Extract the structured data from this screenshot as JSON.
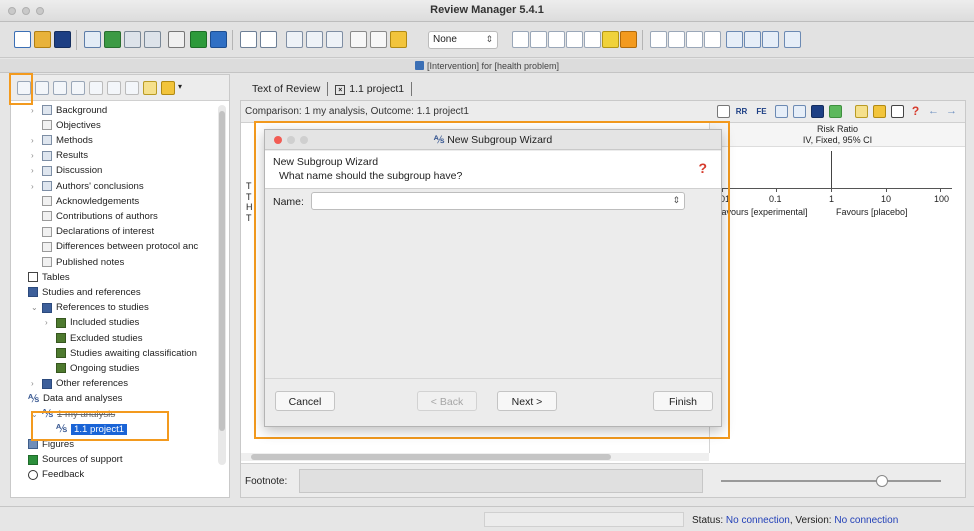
{
  "app": {
    "title": "Review Manager 5.4.1"
  },
  "toolbar": {
    "style_value": "None"
  },
  "document": {
    "window_title": "[Intervention] for [health problem]"
  },
  "sidebar": {
    "items": [
      {
        "label": "Background",
        "indent": 1,
        "icon": "section",
        "twisty": ">"
      },
      {
        "label": "Objectives",
        "indent": 1,
        "icon": "doc",
        "twisty": ""
      },
      {
        "label": "Methods",
        "indent": 1,
        "icon": "section",
        "twisty": ">"
      },
      {
        "label": "Results",
        "indent": 1,
        "icon": "section",
        "twisty": ">"
      },
      {
        "label": "Discussion",
        "indent": 1,
        "icon": "section",
        "twisty": ">"
      },
      {
        "label": "Authors' conclusions",
        "indent": 1,
        "icon": "section",
        "twisty": ">"
      },
      {
        "label": "Acknowledgements",
        "indent": 1,
        "icon": "doc",
        "twisty": ""
      },
      {
        "label": "Contributions of authors",
        "indent": 1,
        "icon": "doc",
        "twisty": ""
      },
      {
        "label": "Declarations of interest",
        "indent": 1,
        "icon": "doc",
        "twisty": ""
      },
      {
        "label": "Differences between protocol anc",
        "indent": 1,
        "icon": "doc",
        "twisty": ""
      },
      {
        "label": "Published notes",
        "indent": 1,
        "icon": "doc",
        "twisty": ""
      },
      {
        "label": "Tables",
        "indent": 0,
        "icon": "table",
        "twisty": ""
      },
      {
        "label": "Studies and references",
        "indent": 0,
        "icon": "folder",
        "twisty": ""
      },
      {
        "label": "References to studies",
        "indent": 1,
        "icon": "folder",
        "twisty": "v"
      },
      {
        "label": "Included studies",
        "indent": 2,
        "icon": "study",
        "twisty": ">"
      },
      {
        "label": "Excluded studies",
        "indent": 2,
        "icon": "study",
        "twisty": ""
      },
      {
        "label": "Studies awaiting classification",
        "indent": 2,
        "icon": "study",
        "twisty": ""
      },
      {
        "label": "Ongoing studies",
        "indent": 2,
        "icon": "study",
        "twisty": ""
      },
      {
        "label": "Other references",
        "indent": 1,
        "icon": "folder",
        "twisty": ">"
      },
      {
        "label": "Data and analyses",
        "indent": 0,
        "icon": "comp",
        "twisty": ""
      },
      {
        "label": "1 my analysis",
        "indent": 1,
        "icon": "comp",
        "twisty": "v",
        "strike": true
      },
      {
        "label": "1.1 project1",
        "indent": 2,
        "icon": "comp",
        "twisty": "",
        "selected": true
      },
      {
        "label": "Figures",
        "indent": 0,
        "icon": "fig",
        "twisty": ""
      },
      {
        "label": "Sources of support",
        "indent": 0,
        "icon": "sup",
        "twisty": ""
      },
      {
        "label": "Feedback",
        "indent": 0,
        "icon": "fb",
        "twisty": ""
      }
    ]
  },
  "tabs": [
    {
      "label": "Text of Review"
    },
    {
      "label": "1.1 project1",
      "closable": true
    }
  ],
  "content": {
    "comparison": "Comparison: 1 my analysis, Outcome: 1.1 project1",
    "left_letters": [
      "T",
      "T",
      "H",
      "T"
    ],
    "toolbar_labels": {
      "rr": "RR",
      "fe": "FE"
    },
    "forest": {
      "header_line1": "Risk Ratio",
      "header_line2": "IV, Fixed, 95% CI",
      "ticks": [
        "01",
        "0.1",
        "1",
        "10",
        "100"
      ],
      "favours_left": "Favours [experimental]",
      "favours_right": "Favours [placebo]"
    },
    "footnote_label": "Footnote:"
  },
  "dialog": {
    "title": "New Subgroup Wizard",
    "header_title": "New Subgroup Wizard",
    "question": "What name should the subgroup have?",
    "name_label": "Name:",
    "name_value": "",
    "buttons": {
      "cancel": "Cancel",
      "back": "< Back",
      "next": "Next >",
      "finish": "Finish"
    }
  },
  "status": {
    "prefix": "Status:",
    "connection": "No connection",
    "version_prefix": ", Version:",
    "version": "No connection"
  },
  "colors": {
    "highlight": "#f39a1e",
    "selection": "#1a64d6",
    "status_blue": "#2341b8"
  }
}
